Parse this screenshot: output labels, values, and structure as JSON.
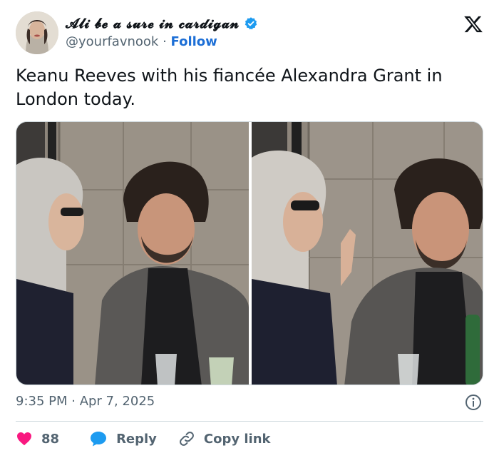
{
  "author": {
    "display_name": "𝓐𝓵𝓲 𝓫𝓮 𝓪 𝓼𝓾𝓻𝓮 𝓲𝓷 𝓬𝓪𝓻𝓭𝓲𝓰𝓪𝓷",
    "handle": "@yourfavnook",
    "separator": " · ",
    "follow_label": "Follow",
    "verified": true
  },
  "tweet": {
    "text": "Keanu Reeves with his fiancée Alexandra Grant in London today."
  },
  "meta": {
    "timestamp": "9:35 PM · Apr 7, 2025"
  },
  "actions": {
    "like_count": "88",
    "reply_label": "Reply",
    "copy_link_label": "Copy link"
  },
  "colors": {
    "accent": "#1d6fd6",
    "verified": "#1d9bf0",
    "like": "#f91880",
    "reply": "#1d9bf0",
    "muted": "#536471"
  },
  "icons": {
    "brand": "x-logo-icon",
    "verified": "verified-badge-icon",
    "info": "info-icon",
    "like": "heart-icon",
    "reply": "speech-bubble-icon",
    "copy_link": "link-icon"
  }
}
